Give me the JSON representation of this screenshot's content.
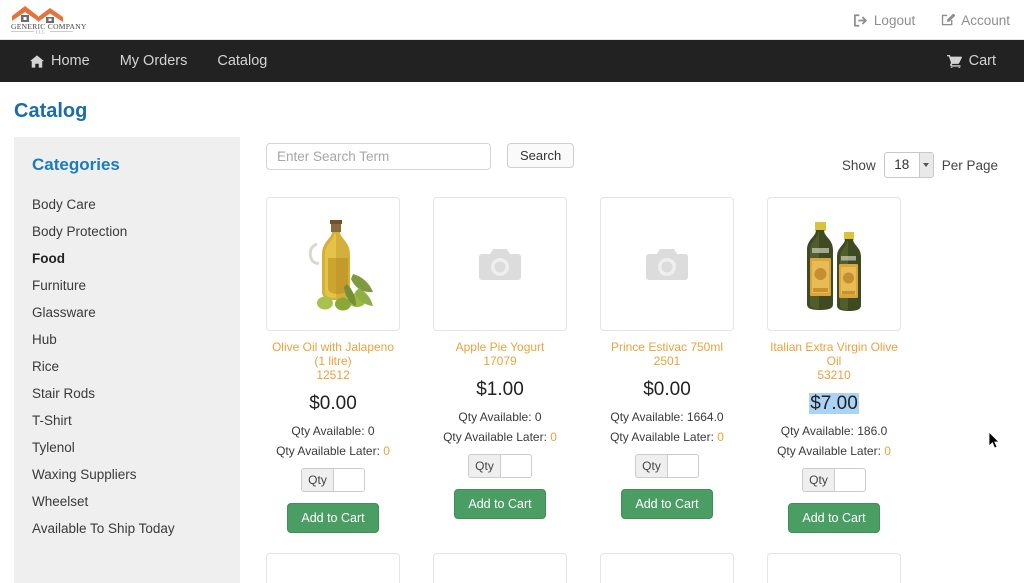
{
  "brand": {
    "name_line1": "GENERIC COMPANY",
    "name_line2": "LLC"
  },
  "utility_nav": [
    {
      "label": "Logout",
      "icon": "logout-icon"
    },
    {
      "label": "Account",
      "icon": "edit-square-icon"
    }
  ],
  "navbar": {
    "links": [
      {
        "label": "Home",
        "icon": "home-icon"
      },
      {
        "label": "My Orders",
        "icon": ""
      },
      {
        "label": "Catalog",
        "icon": ""
      }
    ],
    "cart_label": "Cart",
    "cart_icon": "shopping-cart-icon"
  },
  "page": {
    "title": "Catalog"
  },
  "sidebar": {
    "heading": "Categories",
    "items": [
      {
        "label": "Body Care",
        "active": false
      },
      {
        "label": "Body Protection",
        "active": false
      },
      {
        "label": "Food",
        "active": true
      },
      {
        "label": "Furniture",
        "active": false
      },
      {
        "label": "Glassware",
        "active": false
      },
      {
        "label": "Hub",
        "active": false
      },
      {
        "label": "Rice",
        "active": false
      },
      {
        "label": "Stair Rods",
        "active": false
      },
      {
        "label": "T-Shirt",
        "active": false
      },
      {
        "label": "Tylenol",
        "active": false
      },
      {
        "label": "Waxing Suppliers",
        "active": false
      },
      {
        "label": "Wheelset",
        "active": false
      },
      {
        "label": "Available To Ship Today",
        "active": false
      }
    ]
  },
  "toolbar": {
    "search_placeholder": "Enter Search Term",
    "search_value": "",
    "search_button": "Search",
    "show_label": "Show",
    "per_page_value": "18",
    "per_page_label": "Per Page"
  },
  "labels": {
    "qty_available": "Qty Available:",
    "qty_available_later": "Qty Available Later:",
    "qty_addon": "Qty",
    "add_to_cart": "Add to Cart"
  },
  "products": [
    {
      "name": "Olive Oil with Jalapeno (1 litre)",
      "sku": "12512",
      "price": "$0.00",
      "price_selected": false,
      "qty_available": "0",
      "qty_available_later": "0",
      "qty_value": "",
      "image": "olive-oil-bottle-image"
    },
    {
      "name": "Apple Pie Yogurt",
      "sku": "17079",
      "price": "$1.00",
      "price_selected": false,
      "qty_available": "0",
      "qty_available_later": "0",
      "qty_value": "",
      "image": "camera-placeholder-icon"
    },
    {
      "name": "Prince Estivac 750ml",
      "sku": "2501",
      "price": "$0.00",
      "price_selected": false,
      "qty_available": "1664.0",
      "qty_available_later": "0",
      "qty_value": "",
      "image": "camera-placeholder-icon"
    },
    {
      "name": "Italian Extra Virgin Olive Oil",
      "sku": "53210",
      "price": "$7.00",
      "price_selected": true,
      "qty_available": "186.0",
      "qty_available_later": "0",
      "qty_value": "",
      "image": "two-olive-oil-bottles-image"
    }
  ],
  "colors": {
    "brand_orange": "#e8733a",
    "link_orange": "#e8a33d",
    "title_blue": "#1b6ca8",
    "button_green": "#4a9d63",
    "navbar_dark": "#222222",
    "selection_blue": "#aad3f5"
  }
}
